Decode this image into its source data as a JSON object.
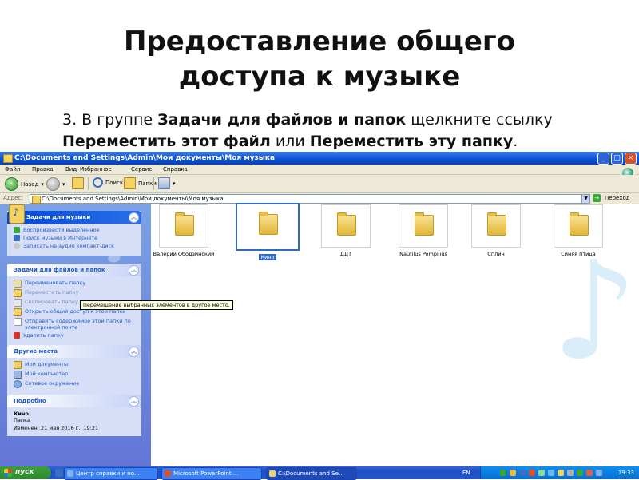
{
  "slide": {
    "title_line1": "Предоставление общего",
    "title_line2": "доступа к музыке",
    "text_prefix": "3. В группе ",
    "text_bold1": "Задачи для файлов и папок",
    "text_mid": " щелкните ссылку ",
    "text_bold2": "Переместить этот файл",
    "text_or": " или ",
    "text_bold3": "Переместить эту папку",
    "text_end": "."
  },
  "window": {
    "title": "C:\\Documents and Settings\\Admin\\Мои документы\\Моя музыка",
    "menu": [
      "Файл",
      "Правка",
      "Вид",
      "Избранное",
      "Сервис",
      "Справка"
    ],
    "toolbar": {
      "back": "Назад",
      "search": "Поиск",
      "folders": "Папки"
    },
    "address_label": "Адрес:",
    "address_value": "C:\\Documents and Settings\\Admin\\Мои документы\\Моя музыка",
    "go_label": "Переход"
  },
  "taskpane": {
    "music_tasks": {
      "title": "Задачи для музыки",
      "items": [
        "Воспроизвести выделенное",
        "Поиск музыки в Интернете",
        "Записать на аудио компакт-диск"
      ]
    },
    "file_tasks": {
      "title": "Задачи для файлов и папок",
      "items": [
        "Переименовать папку",
        "Переместить папку",
        "Скопировать папку",
        "Открыть общий доступ к этой папке",
        "Отправить содержимое этой папки по электронной почте",
        "Удалить папку"
      ]
    },
    "other_places": {
      "title": "Другие места",
      "items": [
        "Мои документы",
        "Мой компьютер",
        "Сетевое окружение"
      ]
    },
    "details": {
      "title": "Подробно",
      "name": "Кино",
      "type": "Папка",
      "modified": "Изменен: 21 мая 2016 г., 19:21"
    }
  },
  "tooltip": "Перемещение выбранных элементов в другое место.",
  "folders": [
    {
      "name": "Валерий Ободзинский",
      "selected": false
    },
    {
      "name": "Кино",
      "selected": true
    },
    {
      "name": "ДДТ",
      "selected": false
    },
    {
      "name": "Nautilus Pompilius",
      "selected": false
    },
    {
      "name": "Сплин",
      "selected": false
    },
    {
      "name": "Синяя птица",
      "selected": false
    }
  ],
  "taskbar": {
    "start": "пуск",
    "tasks": [
      "Центр справки и по...",
      "Microsoft PowerPoint ...",
      "C:\\Documents and Se..."
    ],
    "lang": "EN",
    "clock": "19:33"
  },
  "colors": {
    "xp_blue": "#0a4fd1",
    "selection": "#316ac5",
    "link": "#215dc6"
  }
}
